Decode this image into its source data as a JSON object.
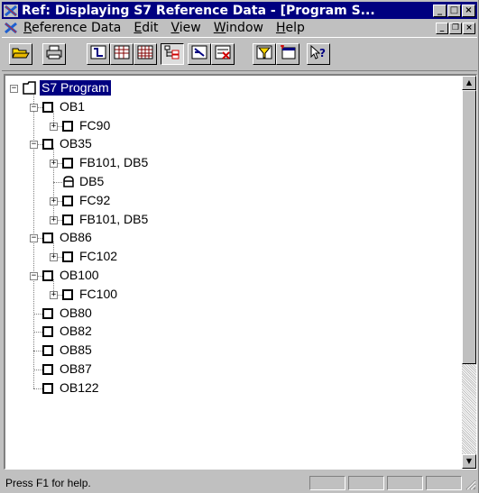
{
  "window": {
    "title": "Ref: Displaying S7 Reference Data - [Program S...",
    "app_icon": "x-logo-icon",
    "caption_buttons": [
      "minimize",
      "maximize",
      "close"
    ]
  },
  "menu": {
    "items": [
      {
        "label": "Reference Data",
        "mnemonic": "R"
      },
      {
        "label": "Edit",
        "mnemonic": "E"
      },
      {
        "label": "View",
        "mnemonic": "V"
      },
      {
        "label": "Window",
        "mnemonic": "W"
      },
      {
        "label": "Help",
        "mnemonic": "H"
      }
    ]
  },
  "toolbar": {
    "buttons": [
      {
        "name": "open-icon"
      },
      {
        "name": "print-icon"
      },
      {
        "name": "cross-reference-icon"
      },
      {
        "name": "assignment-list-icon"
      },
      {
        "name": "io-list-icon"
      },
      {
        "name": "program-structure-icon",
        "pressed": true
      },
      {
        "name": "unused-symbols-icon"
      },
      {
        "name": "addresses-without-symbols-icon"
      },
      {
        "name": "filter-icon"
      },
      {
        "name": "new-window-icon"
      },
      {
        "name": "context-help-icon"
      }
    ]
  },
  "tree": {
    "nodes": [
      {
        "label": "S7 Program",
        "icon": "folder",
        "level": 0,
        "expander": "-",
        "selected": true
      },
      {
        "label": "OB1",
        "icon": "block",
        "level": 1,
        "expander": "-"
      },
      {
        "label": "FC90",
        "icon": "block",
        "level": 2,
        "expander": "+"
      },
      {
        "label": "OB35",
        "icon": "block",
        "level": 1,
        "expander": "-"
      },
      {
        "label": "FB101, DB5",
        "icon": "block",
        "level": 2,
        "expander": "+"
      },
      {
        "label": "DB5",
        "icon": "db",
        "level": 2,
        "expander": ""
      },
      {
        "label": "FC92",
        "icon": "block",
        "level": 2,
        "expander": "+"
      },
      {
        "label": "FB101, DB5",
        "icon": "block",
        "level": 2,
        "expander": "+"
      },
      {
        "label": "OB86",
        "icon": "block",
        "level": 1,
        "expander": "-"
      },
      {
        "label": "FC102",
        "icon": "block",
        "level": 2,
        "expander": "+"
      },
      {
        "label": "OB100",
        "icon": "block",
        "level": 1,
        "expander": "-"
      },
      {
        "label": "FC100",
        "icon": "block",
        "level": 2,
        "expander": "+"
      },
      {
        "label": "OB80",
        "icon": "block",
        "level": 1,
        "expander": ""
      },
      {
        "label": "OB82",
        "icon": "block",
        "level": 1,
        "expander": ""
      },
      {
        "label": "OB85",
        "icon": "block",
        "level": 1,
        "expander": ""
      },
      {
        "label": "OB87",
        "icon": "block",
        "level": 1,
        "expander": ""
      },
      {
        "label": "OB122",
        "icon": "block",
        "level": 1,
        "expander": ""
      }
    ]
  },
  "statusbar": {
    "text": "Press F1 for help."
  },
  "colors": {
    "title_bar": "#000080",
    "selection": "#000080",
    "face": "#c0c0c0"
  }
}
